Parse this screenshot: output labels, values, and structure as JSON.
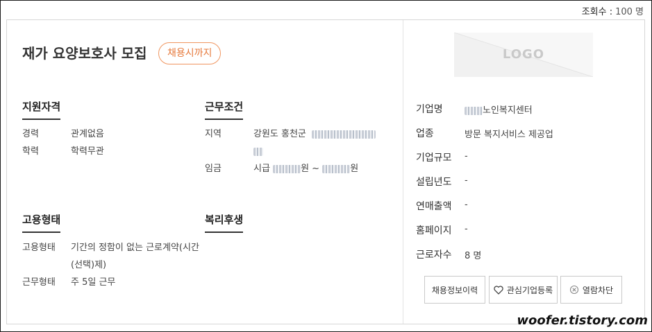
{
  "views": {
    "label": "조회수 :",
    "count": "100 명"
  },
  "job": {
    "title": "재가 요양보호사 모집",
    "deadline_badge": "채용시까지"
  },
  "qualification": {
    "heading": "지원자격",
    "rows": [
      {
        "label": "경력",
        "value": "관계없음"
      },
      {
        "label": "학력",
        "value": "학력무관"
      }
    ]
  },
  "conditions": {
    "heading": "근무조건",
    "region_label": "지역",
    "region_value": "강원도 홍천군",
    "wage_label": "임금",
    "wage_prefix": "시급",
    "wage_unit1": "원 ~",
    "wage_unit2": "원"
  },
  "employment": {
    "heading": "고용형태",
    "rows": [
      {
        "label": "고용형태",
        "value": "기간의 정함이 없는 근로계약(시간(선택)제)"
      },
      {
        "label": "근무형태",
        "value": "주 5일 근무"
      }
    ]
  },
  "benefits": {
    "heading": "복리후생"
  },
  "company": {
    "logo_text": "LOGO",
    "rows": [
      {
        "label": "기업명",
        "value": "노인복지센터"
      },
      {
        "label": "업종",
        "value": "방문 복지서비스 제공업"
      },
      {
        "label": "기업규모",
        "value": "-"
      },
      {
        "label": "설립년도",
        "value": "-"
      },
      {
        "label": "연매출액",
        "value": "-"
      },
      {
        "label": "홈페이지",
        "value": "-"
      },
      {
        "label": "근로자수",
        "value": "8 명"
      }
    ]
  },
  "actions": {
    "history": "채용정보이력",
    "follow": "관심기업등록",
    "block": "열람차단"
  },
  "watermark": "woofer.tistory.com"
}
